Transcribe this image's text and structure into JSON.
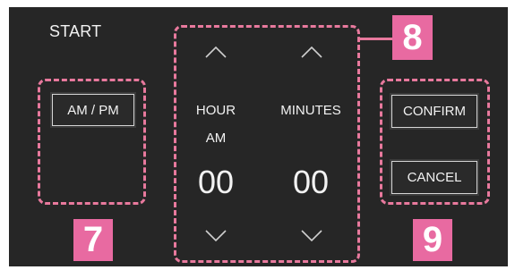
{
  "screen": {
    "title": "START"
  },
  "ampm_button": {
    "label": "AM / PM"
  },
  "time_picker": {
    "hour_label": "HOUR",
    "period": "AM",
    "hour_value": "00",
    "minutes_label": "MINUTES",
    "minutes_value": "00"
  },
  "actions": {
    "confirm_label": "CONFIRM",
    "cancel_label": "CANCEL"
  },
  "callouts": {
    "badge_7": "7",
    "badge_8": "8",
    "badge_9": "9"
  },
  "colors": {
    "callout_pink": "#e86aa1",
    "background": "#262626",
    "text": "#f2f2f2"
  },
  "icons": {
    "up": "chevron-up-icon",
    "down": "chevron-down-icon"
  }
}
